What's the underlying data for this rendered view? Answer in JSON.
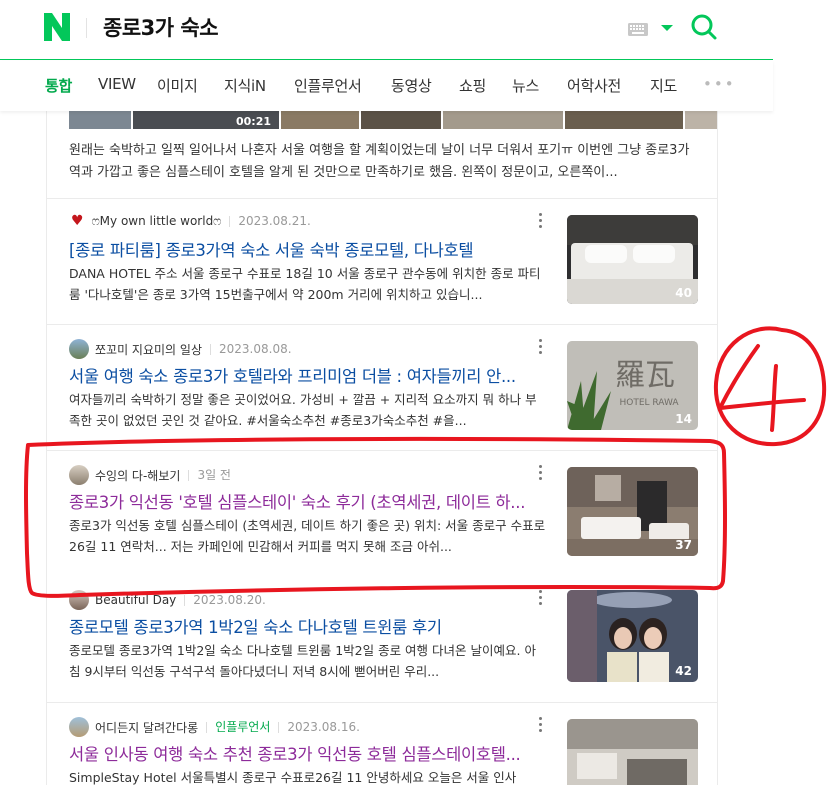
{
  "search": {
    "query": "종로3가 숙소"
  },
  "tabs": [
    "통합",
    "VIEW",
    "이미지",
    "지식iN",
    "인플루언서",
    "동영상",
    "쇼핑",
    "뉴스",
    "어학사전",
    "지도"
  ],
  "tabs_more": "•••",
  "top_strip": {
    "badge": "00:21"
  },
  "top_snippet": "원래는 숙박하고 일찍 일어나서 나혼자 서울 여행을 할 계획이었는데 날이 너무 더워서 포기ㅠ 이번엔 그냥 종로3가역과 가깝고 좋은 심플스테이 호텔을 알게 된 것만으로 만족하기로 했음. 왼쪽이 정문이고, 오른쪽이...",
  "results": [
    {
      "author": "ෆMy own little worldෆ",
      "date": "2023.08.21.",
      "title": "[종로 파티룸] 종로3가역 숙소 서울 숙박 종로모텔, 다나호텔",
      "desc": "DANA HOTEL 주소 서울 종로구 수표로 18길 10 서울 종로구 관수동에 위치한 종로 파티룸 '다나호텔'은 종로 3가역 15번출구에서 약 200m 거리에 위치하고 있습니...",
      "count": "40"
    },
    {
      "author": "쪼꼬미 지요미의 일상",
      "date": "2023.08.08.",
      "title": "서울 여행 숙소 종로3가 호텔라와 프리미엄 더블 : 여자들끼리 안...",
      "desc": "여자들끼리 숙박하기 정말 좋은 곳이었어요. 가성비 + 깔끔 + 지리적 요소까지 뭐 하나 부족한 곳이 없었던 곳인 것 같아요. #서울숙소추천 #종로3가숙소추천 #을...",
      "count": "14",
      "thumb_text": "羅瓦",
      "thumb_sub": "HOTEL RAWA"
    },
    {
      "author": "수잉의 다-해보기",
      "date": "3일 전",
      "title": "종로3가 익선동 '호텔 심플스테이' 숙소 후기 (초역세권, 데이트 하...",
      "desc": "종로3가 익선동 호텔 심플스테이 (초역세권, 데이트 하기 좋은 곳) 위치: 서울 종로구 수표로26길 11 연락처... 저는 카페인에 민감해서 커피를 먹지 못해 조금 아쉬...",
      "count": "37"
    },
    {
      "author": "Beautiful Day",
      "date": "2023.08.20.",
      "title": "종로모텔 종로3가역 1박2일 숙소 다나호텔 트윈룸 후기",
      "desc": "종로모텔 종로3가역 1박2일 숙소 다나호텔 트윈룸 1박2일 종로 여행 다녀온 날이예요. 아침 9시부터 익선동 구석구석 돌아다녔더니 저녁 8시에 뻗어버린 우리...",
      "count": "42"
    },
    {
      "author": "어디든지 달려간다롱",
      "badge": "인플루언서",
      "date": "2023.08.16.",
      "title": "서울 인사동 여행 숙소 추천 종로3가 익선동 호텔 심플스테이호텔...",
      "desc": "SimpleStay Hotel 서울특별시 종로구 수표로26길 11 안녕하세요 오늘은 서울 인사"
    }
  ],
  "annotation": {
    "number": "4"
  },
  "colors": {
    "brand": "#03c75a",
    "link": "#0b4ea2",
    "visited": "#8d2b9a",
    "annotation": "#e8161f"
  }
}
